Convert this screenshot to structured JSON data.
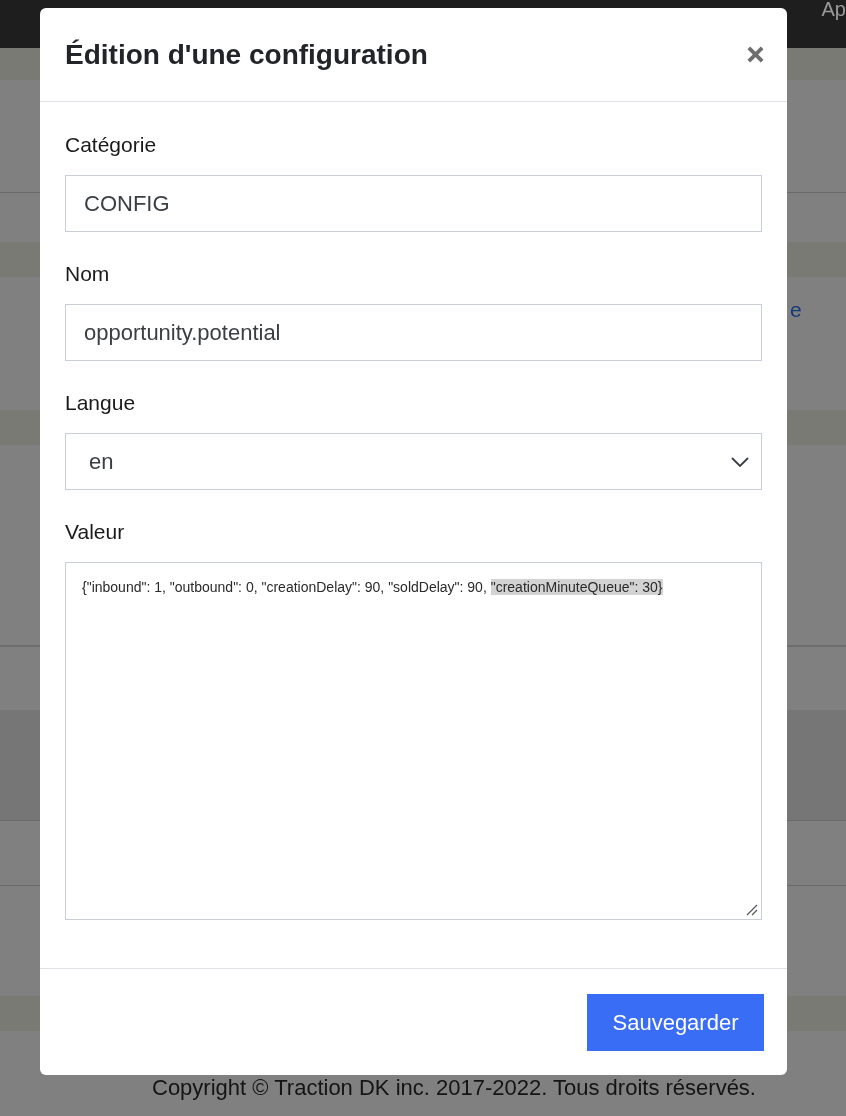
{
  "page": {
    "top_bar": {
      "text": "Ap"
    },
    "link_fragment": "e",
    "footer": "Copyright © Traction DK inc. 2017-2022. Tous droits réservés."
  },
  "modal": {
    "title": "Édition d'une configuration",
    "fields": [
      {
        "kind": "input",
        "label": "Catégorie",
        "value": "CONFIG"
      },
      {
        "kind": "input",
        "label": "Nom",
        "value": "opportunity.potential"
      },
      {
        "kind": "select",
        "label": "Langue",
        "value": "en"
      },
      {
        "kind": "textarea",
        "label": "Valeur",
        "value_parts": [
          {
            "text": "{\"inbound\": 1, \"outbound\": 0, \"creationDelay\": 90, \"soldDelay\": 90, ",
            "selected": false
          },
          {
            "text": "\"creationMinuteQueue\": 30}",
            "selected": true
          }
        ]
      }
    ],
    "buttons": [
      {
        "label": "Sauvegarder"
      }
    ]
  }
}
